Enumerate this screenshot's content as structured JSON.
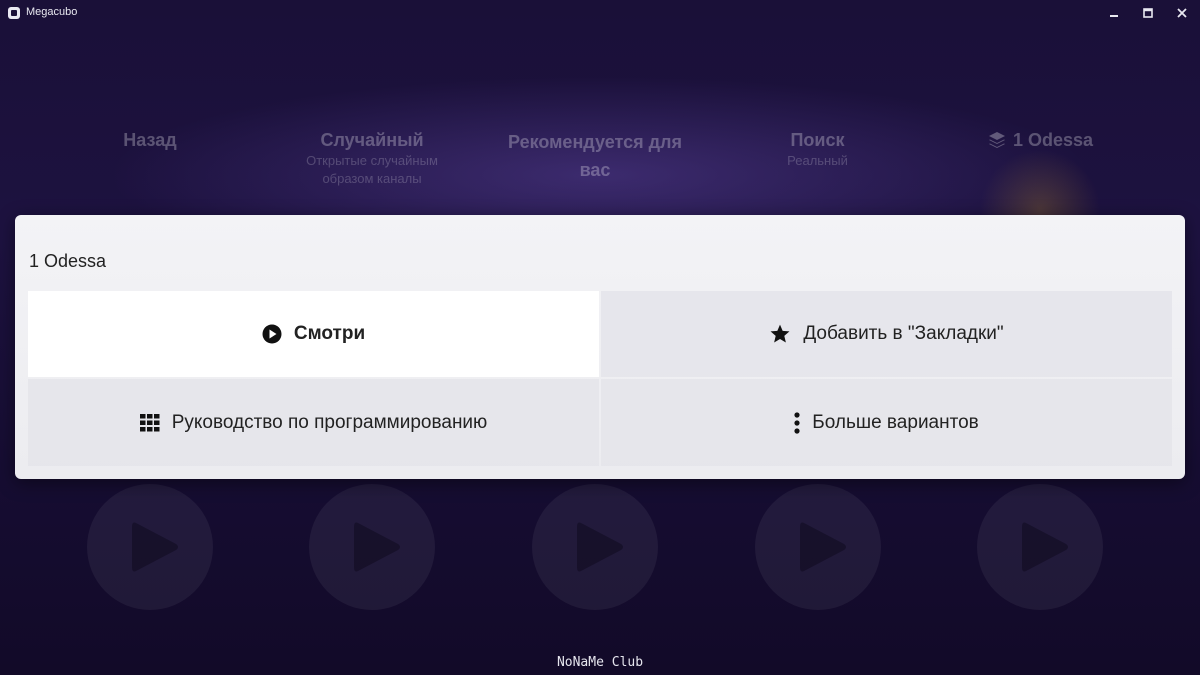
{
  "window": {
    "title": "Megacubo",
    "icons": {
      "minimize": "minimize-icon",
      "maximize": "maximize-icon",
      "close": "close-icon"
    }
  },
  "nav": {
    "back": {
      "label": "Назад"
    },
    "random": {
      "label": "Случайный",
      "sub": "Открытые случайным образом каналы"
    },
    "recommended": {
      "label": "Рекомендуется для вас"
    },
    "search": {
      "label": "Поиск",
      "sub": "Реальный"
    },
    "list": {
      "label": "1 Odessa",
      "icon": "layers-icon"
    }
  },
  "dialog": {
    "title": "1 Odessa",
    "options": [
      {
        "label": "Смотри",
        "icon": "play-circle-icon"
      },
      {
        "label": "Добавить в \"Закладки\"",
        "icon": "star-icon"
      },
      {
        "label": "Руководство по программированию",
        "icon": "grid-icon"
      },
      {
        "label": "Больше вариантов",
        "icon": "more-vertical-icon"
      }
    ]
  },
  "watermark": "NoNaMe Club",
  "colors": {
    "background": "#1a1038",
    "dialog": "#f0f0f3",
    "selected": "#ffffff"
  }
}
